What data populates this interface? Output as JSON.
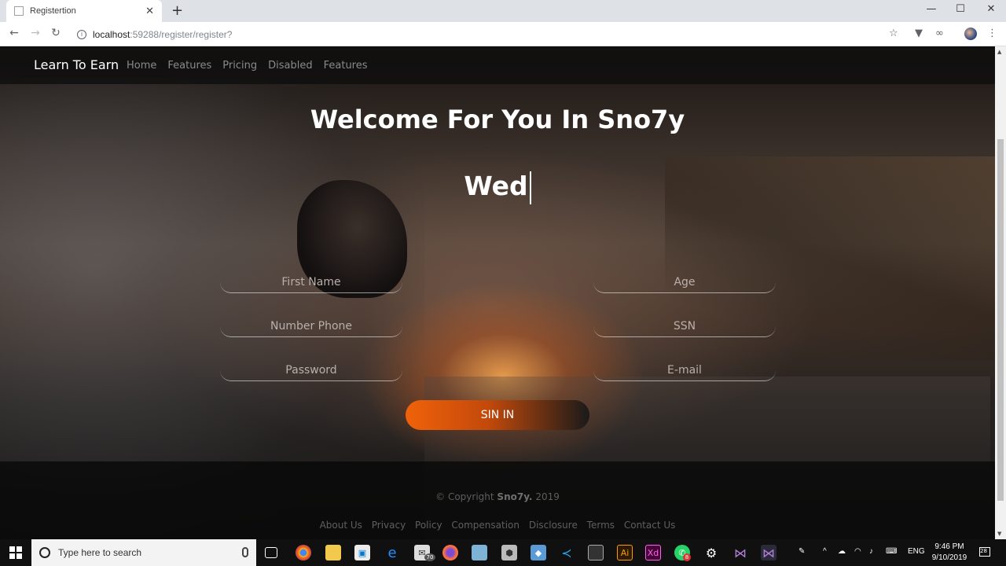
{
  "browser": {
    "tab_title": "Registertion",
    "url_host": "localhost",
    "url_path": ":59288/register/register?"
  },
  "navbar": {
    "brand": "Learn To Earn",
    "links": [
      "Home",
      "Features",
      "Pricing",
      "Disabled",
      "Features"
    ]
  },
  "hero": {
    "heading": "Welcome For You In Sno7y",
    "typed_text": "Wed"
  },
  "form": {
    "first_name_placeholder": "First Name",
    "age_placeholder": "Age",
    "phone_placeholder": "Number Phone",
    "ssn_placeholder": "SSN",
    "password_placeholder": "Password",
    "email_placeholder": "E-mail",
    "submit_label": "SIN IN"
  },
  "footer": {
    "copyright_prefix": "© Copyright",
    "copyright_brand": "Sno7y.",
    "copyright_year": "2019",
    "links": [
      "About Us",
      "Privacy",
      "Policy",
      "Compensation",
      "Disclosure",
      "Terms",
      "Contact Us"
    ]
  },
  "taskbar": {
    "search_placeholder": "Type here to search",
    "mail_badge": "70",
    "whatsapp_badge": "8",
    "language": "ENG",
    "time": "9:46 PM",
    "date": "9/10/2019",
    "notification_count": "28"
  },
  "colors": {
    "accent_orange": "#f0620a",
    "navbar_bg": "#0f0f0f"
  }
}
